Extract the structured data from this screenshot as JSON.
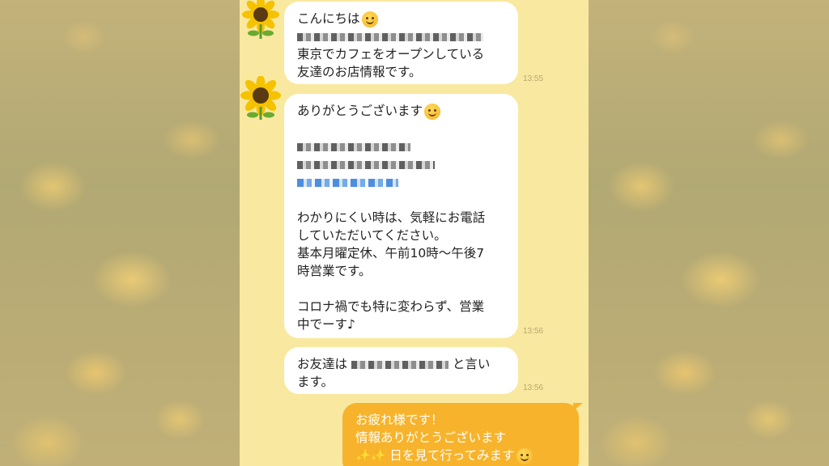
{
  "chat": {
    "messages": [
      {
        "lines": [
          "こんにちは",
          "東京でカフェをオープンしている",
          "友達のお店情報です。"
        ],
        "emoji": "smiling-face-with-hearts",
        "time": "13:55"
      },
      {
        "lines": [
          "ありがとうございます",
          "わかりにくい時は、気軽にお電話",
          "していただいてください。",
          "基本月曜定休、午前10時〜午後7",
          "時営業です。",
          "コロナ禍でも特に変わらず、営業",
          "中でーす♪"
        ],
        "emoji": "smiling-face",
        "time": "13:56"
      },
      {
        "lines": [
          "お友達は",
          "と言い",
          "ます。"
        ],
        "time": "13:56"
      },
      {
        "lines": [
          "お疲れ様です！",
          "情報ありがとうございます",
          "日を見て行ってみます"
        ],
        "emoji": "smiling-face"
      }
    ]
  },
  "colors": {
    "chat_bg": "#f9e8a0",
    "incoming_bubble": "#ffffff",
    "outgoing_bubble": "#f7b32b",
    "timestamp": "#b8a870"
  },
  "icons": {
    "avatar": "sunflower-icon"
  }
}
